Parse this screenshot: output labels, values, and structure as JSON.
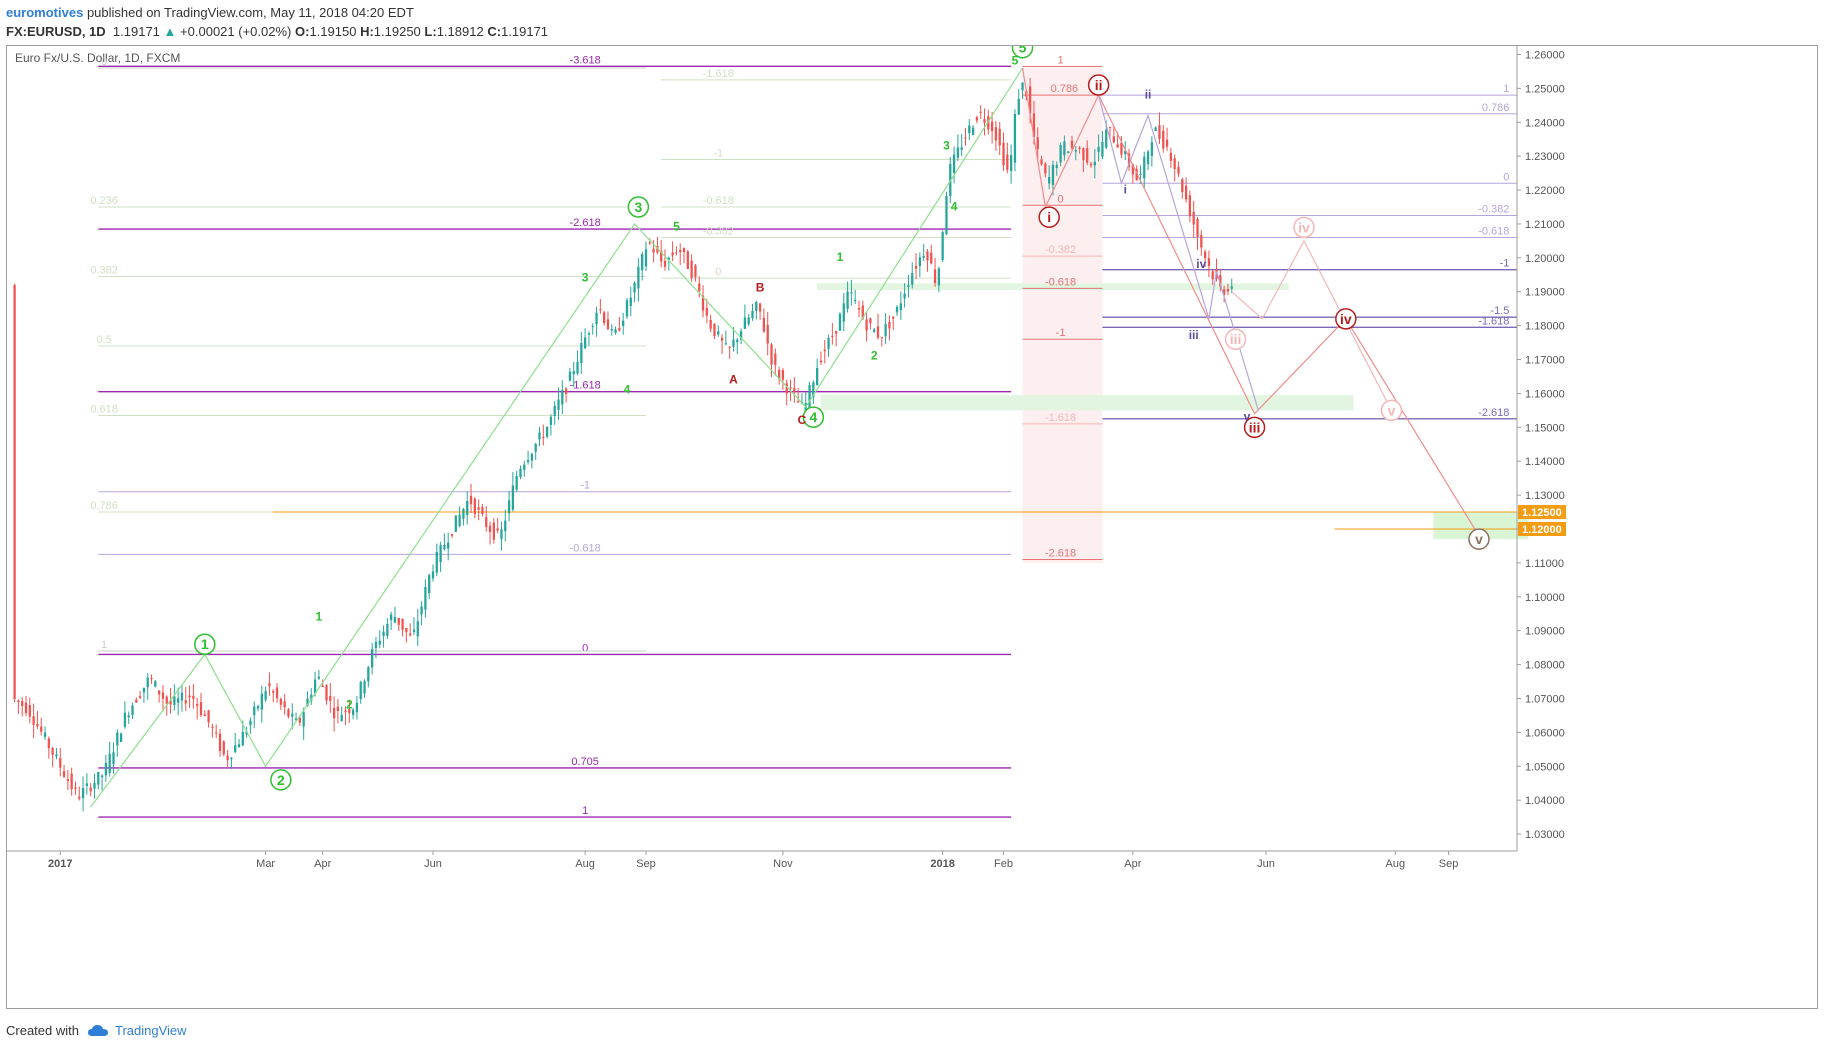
{
  "header": {
    "author": "euromotives",
    "published_text": "published on TradingView.com, May 11, 2018 04:20 EDT"
  },
  "quote": {
    "symbol": "FX:EURUSD, 1D",
    "last": "1.19171",
    "change": "+0.00021 (+0.02%)",
    "o_label": "O:",
    "o": "1.19150",
    "h_label": "H:",
    "h": "1.19250",
    "l_label": "L:",
    "l": "1.18912",
    "c_label": "C:",
    "c": "1.19171"
  },
  "footer": {
    "created_with": "Created with",
    "brand": "TradingView"
  },
  "colors": {
    "up": "#26a69a",
    "down": "#ef5350",
    "green_wave": "#2fbf2f",
    "red_wave": "#b71c1c",
    "purple": "#9c27b0",
    "violet": "#7b68b8",
    "orange": "#f39c12",
    "pink": "#e57373"
  },
  "chart_data": {
    "type": "candlestick",
    "title": "Euro Fx/U.S. Dollar, 1D, FXCM",
    "x_ticks": [
      "2017",
      "Mar",
      "Apr",
      "Jun",
      "Aug",
      "Sep",
      "Nov",
      "2018",
      "Feb",
      "Apr",
      "Jun",
      "Aug",
      "Sep"
    ],
    "ylim": [
      1.025,
      1.2625
    ],
    "y_ticks": [
      "1.26000",
      "1.25000",
      "1.24000",
      "1.23000",
      "1.22000",
      "1.21000",
      "1.20000",
      "1.19000",
      "1.18000",
      "1.17000",
      "1.16000",
      "1.15000",
      "1.14000",
      "1.13000",
      "1.12000",
      "1.11000",
      "1.10000",
      "1.09000",
      "1.08000",
      "1.07000",
      "1.06000",
      "1.05000",
      "1.04000",
      "1.03000"
    ],
    "price_badges": [
      {
        "label": "1.12500",
        "value": 1.125,
        "color": "#f39c12"
      },
      {
        "label": "1.12000",
        "value": 1.12,
        "color": "#f39c12"
      }
    ],
    "price_path": [
      [
        0,
        1.07
      ],
      [
        4,
        1.067
      ],
      [
        10,
        1.055
      ],
      [
        17,
        1.041
      ],
      [
        24,
        1.048
      ],
      [
        30,
        1.066
      ],
      [
        36,
        1.076
      ],
      [
        41,
        1.068
      ],
      [
        47,
        1.071
      ],
      [
        52,
        1.062
      ],
      [
        56,
        1.052
      ],
      [
        61,
        1.06
      ],
      [
        67,
        1.074
      ],
      [
        71,
        1.067
      ],
      [
        75,
        1.062
      ],
      [
        80,
        1.077
      ],
      [
        85,
        1.065
      ],
      [
        90,
        1.068
      ],
      [
        95,
        1.085
      ],
      [
        100,
        1.095
      ],
      [
        105,
        1.087
      ],
      [
        110,
        1.108
      ],
      [
        115,
        1.119
      ],
      [
        120,
        1.129
      ],
      [
        124,
        1.122
      ],
      [
        128,
        1.117
      ],
      [
        133,
        1.138
      ],
      [
        140,
        1.149
      ],
      [
        146,
        1.163
      ],
      [
        150,
        1.175
      ],
      [
        154,
        1.186
      ],
      [
        158,
        1.176
      ],
      [
        163,
        1.19
      ],
      [
        167,
        1.205
      ],
      [
        171,
        1.198
      ],
      [
        175,
        1.203
      ],
      [
        179,
        1.195
      ],
      [
        183,
        1.181
      ],
      [
        188,
        1.172
      ],
      [
        192,
        1.18
      ],
      [
        196,
        1.186
      ],
      [
        200,
        1.168
      ],
      [
        204,
        1.161
      ],
      [
        208,
        1.155
      ],
      [
        212,
        1.17
      ],
      [
        216,
        1.178
      ],
      [
        220,
        1.19
      ],
      [
        224,
        1.181
      ],
      [
        228,
        1.177
      ],
      [
        232,
        1.183
      ],
      [
        236,
        1.195
      ],
      [
        240,
        1.203
      ],
      [
        243,
        1.192
      ],
      [
        246,
        1.225
      ],
      [
        250,
        1.235
      ],
      [
        254,
        1.243
      ],
      [
        258,
        1.238
      ],
      [
        262,
        1.224
      ],
      [
        264,
        1.247
      ],
      [
        266,
        1.252
      ],
      [
        269,
        1.232
      ],
      [
        272,
        1.222
      ],
      [
        276,
        1.233
      ],
      [
        280,
        1.232
      ],
      [
        284,
        1.228
      ],
      [
        288,
        1.238
      ],
      [
        292,
        1.231
      ],
      [
        296,
        1.222
      ],
      [
        300,
        1.238
      ],
      [
        304,
        1.232
      ],
      [
        308,
        1.219
      ],
      [
        312,
        1.205
      ],
      [
        315,
        1.196
      ],
      [
        318,
        1.19
      ],
      [
        320,
        1.192
      ]
    ],
    "horizontal_levels": [
      {
        "label": "-3.618",
        "value": 1.2565,
        "color": "#9c27b0"
      },
      {
        "label": "-2.618",
        "value": 1.2085,
        "color": "#9c27b0"
      },
      {
        "label": "-1.618",
        "value": 1.1605,
        "color": "#9c27b0"
      },
      {
        "label": "-1",
        "value": 1.131,
        "color": "#b6a5d9"
      },
      {
        "label": "-0.618",
        "value": 1.1125,
        "color": "#b6a5d9"
      },
      {
        "label": "0",
        "value": 1.083,
        "color": "#9c27b0"
      },
      {
        "label": "0.705",
        "value": 1.0495,
        "color": "#9c27b0"
      },
      {
        "label": "1",
        "value": 1.035,
        "color": "#9c27b0"
      },
      {
        "label": "1",
        "value": 1.084,
        "color": "#cccccc"
      },
      {
        "label": "0",
        "value": 1.256,
        "color": "#cccccc"
      },
      {
        "label": "0.236",
        "value": 1.215,
        "color": "#cfe0c4"
      },
      {
        "label": "0.382",
        "value": 1.1945,
        "color": "#cfe0c4"
      },
      {
        "label": "0.5",
        "value": 1.174,
        "color": "#cfe0c4"
      },
      {
        "label": "0.618",
        "value": 1.1535,
        "color": "#cfe0c4"
      },
      {
        "label": "0.786",
        "value": 1.125,
        "color": "#cfe0c4"
      },
      {
        "label": "-1.618",
        "value": 1.2525,
        "color": "#cfe0c4"
      },
      {
        "label": "-1",
        "value": 1.229,
        "color": "#cfe0c4"
      },
      {
        "label": "-0.618",
        "value": 1.215,
        "color": "#cfe0c4"
      },
      {
        "label": "-0.382",
        "value": 1.206,
        "color": "#cfe0c4"
      },
      {
        "label": "0",
        "value": 1.194,
        "color": "#cfe0c4"
      },
      {
        "label": "1",
        "value": 1.2565,
        "color": "#e57373"
      },
      {
        "label": "0.786",
        "value": 1.248,
        "color": "#e57373"
      },
      {
        "label": "0",
        "value": 1.2155,
        "color": "#e57373"
      },
      {
        "label": "-0.382",
        "value": 1.2005,
        "color": "#f4b6b6"
      },
      {
        "label": "-0.618",
        "value": 1.191,
        "color": "#e57373"
      },
      {
        "label": "-1",
        "value": 1.176,
        "color": "#e57373"
      },
      {
        "label": "-1.618",
        "value": 1.151,
        "color": "#f4b6b6"
      },
      {
        "label": "-2.618",
        "value": 1.111,
        "color": "#e57373"
      },
      {
        "label": "1",
        "value": 1.248,
        "color": "#b6a5d9"
      },
      {
        "label": "0.786",
        "value": 1.2425,
        "color": "#b6a5d9"
      },
      {
        "label": "0",
        "value": 1.222,
        "color": "#b6a5d9"
      },
      {
        "label": "-0.382",
        "value": 1.2125,
        "color": "#b6a5d9"
      },
      {
        "label": "-0.618",
        "value": 1.206,
        "color": "#b6a5d9"
      },
      {
        "label": "-1",
        "value": 1.1965,
        "color": "#7b68b8"
      },
      {
        "label": "-1.5",
        "value": 1.1825,
        "color": "#7b68b8"
      },
      {
        "label": "-1.618",
        "value": 1.1795,
        "color": "#7b68b8"
      },
      {
        "label": "-2.618",
        "value": 1.1525,
        "color": "#7b68b8"
      }
    ],
    "wave_labels_circled": [
      {
        "label": "1",
        "t": 50,
        "value": 1.086,
        "color": "#2fbf2f"
      },
      {
        "label": "2",
        "t": 70,
        "value": 1.046,
        "color": "#2fbf2f"
      },
      {
        "label": "3",
        "t": 164,
        "value": 1.215,
        "color": "#2fbf2f"
      },
      {
        "label": "4",
        "t": 210,
        "value": 1.153,
        "color": "#2fbf2f"
      },
      {
        "label": "5",
        "t": 265,
        "value": 1.262,
        "color": "#2fbf2f"
      },
      {
        "label": "ii",
        "t": 285,
        "value": 1.251,
        "color": "#b71c1c"
      },
      {
        "label": "i",
        "t": 272,
        "value": 1.212,
        "color": "#b71c1c"
      },
      {
        "label": "iii",
        "t": 326,
        "value": 1.15,
        "color": "#b71c1c"
      },
      {
        "label": "iv",
        "t": 350,
        "value": 1.182,
        "color": "#b71c1c"
      },
      {
        "label": "v",
        "t": 385,
        "value": 1.117,
        "color": "#8d6e63"
      },
      {
        "label": "iii",
        "t": 321,
        "value": 1.176,
        "color": "#f4b6b6"
      },
      {
        "label": "iv",
        "t": 339,
        "value": 1.209,
        "color": "#f4b6b6"
      },
      {
        "label": "v",
        "t": 362,
        "value": 1.155,
        "color": "#f4b6b6"
      }
    ],
    "wave_labels_plain": [
      {
        "label": "1",
        "t": 80,
        "value": 1.093,
        "color": "#2fbf2f"
      },
      {
        "label": "2",
        "t": 88,
        "value": 1.067,
        "color": "#2fbf2f"
      },
      {
        "label": "3",
        "t": 150,
        "value": 1.193,
        "color": "#2fbf2f"
      },
      {
        "label": "4",
        "t": 161,
        "value": 1.16,
        "color": "#2fbf2f"
      },
      {
        "label": "5",
        "t": 174,
        "value": 1.208,
        "color": "#2fbf2f"
      },
      {
        "label": "1",
        "t": 217,
        "value": 1.199,
        "color": "#2fbf2f"
      },
      {
        "label": "2",
        "t": 226,
        "value": 1.17,
        "color": "#2fbf2f"
      },
      {
        "label": "3",
        "t": 245,
        "value": 1.232,
        "color": "#2fbf2f"
      },
      {
        "label": "4",
        "t": 247,
        "value": 1.214,
        "color": "#2fbf2f"
      },
      {
        "label": "5",
        "t": 263,
        "value": 1.257,
        "color": "#2fbf2f"
      },
      {
        "label": "A",
        "t": 189,
        "value": 1.163,
        "color": "#b71c1c"
      },
      {
        "label": "B",
        "t": 196,
        "value": 1.19,
        "color": "#b71c1c"
      },
      {
        "label": "C",
        "t": 207,
        "value": 1.151,
        "color": "#b71c1c"
      },
      {
        "label": "i",
        "t": 292,
        "value": 1.219,
        "color": "#5c4ba0"
      },
      {
        "label": "ii",
        "t": 298,
        "value": 1.247,
        "color": "#5c4ba0"
      },
      {
        "label": "iii",
        "t": 310,
        "value": 1.176,
        "color": "#5c4ba0"
      },
      {
        "label": "iv",
        "t": 312,
        "value": 1.197,
        "color": "#5c4ba0"
      },
      {
        "label": "v",
        "t": 324,
        "value": 1.152,
        "color": "#5c4ba0"
      }
    ],
    "wave_paths": [
      {
        "color": "#8de08d",
        "points": [
          [
            20,
            1.038
          ],
          [
            50,
            1.083
          ],
          [
            66,
            1.05
          ],
          [
            163,
            1.21
          ],
          [
            208,
            1.156
          ],
          [
            265,
            1.256
          ]
        ]
      },
      {
        "color": "#f08c8c",
        "points": [
          [
            265,
            1.256
          ],
          [
            271,
            1.215
          ],
          [
            285,
            1.248
          ],
          [
            326,
            1.154
          ],
          [
            350,
            1.182
          ],
          [
            385,
            1.118
          ]
        ]
      },
      {
        "color": "#f4b6b6",
        "points": [
          [
            320,
            1.19
          ],
          [
            328,
            1.182
          ],
          [
            339,
            1.205
          ],
          [
            362,
            1.155
          ]
        ]
      },
      {
        "color": "#b6a5d9",
        "points": [
          [
            285,
            1.248
          ],
          [
            291,
            1.222
          ],
          [
            298,
            1.242
          ],
          [
            314,
            1.182
          ],
          [
            316,
            1.196
          ],
          [
            327,
            1.155
          ]
        ]
      }
    ]
  }
}
